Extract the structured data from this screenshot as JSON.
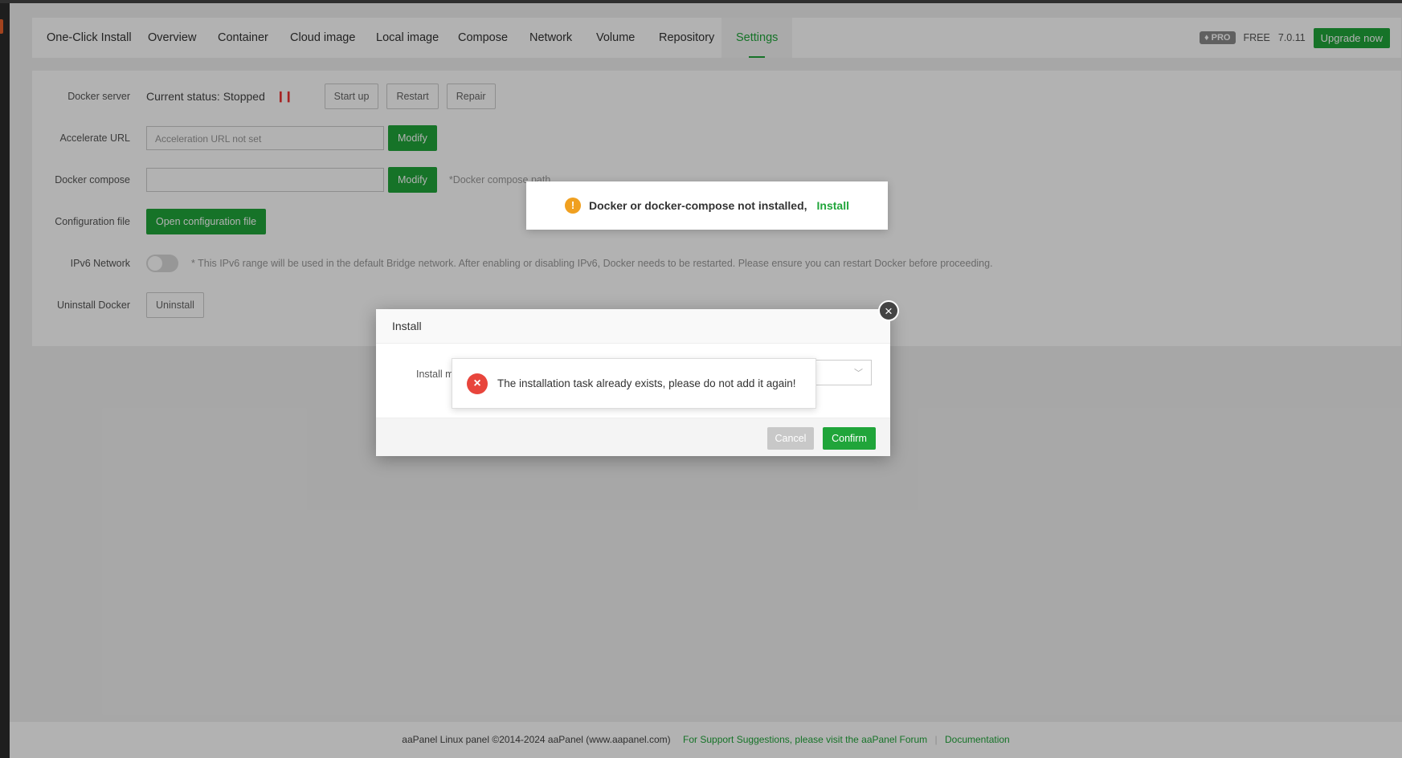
{
  "tabs": [
    {
      "label": "One-Click Install"
    },
    {
      "label": "Overview"
    },
    {
      "label": "Container"
    },
    {
      "label": "Cloud image"
    },
    {
      "label": "Local image"
    },
    {
      "label": "Compose"
    },
    {
      "label": "Network"
    },
    {
      "label": "Volume"
    },
    {
      "label": "Repository"
    },
    {
      "label": "Settings",
      "active": true
    }
  ],
  "header_right": {
    "pro_label": "PRO",
    "plan_label": "FREE",
    "version": "7.0.11",
    "upgrade_label": "Upgrade now"
  },
  "settings": {
    "docker_server": {
      "label": "Docker server",
      "status": "Current status: Stopped",
      "start_label": "Start up",
      "restart_label": "Restart",
      "repair_label": "Repair"
    },
    "accelerate": {
      "label": "Accelerate URL",
      "placeholder": "Acceleration URL not set",
      "modify_label": "Modify"
    },
    "compose": {
      "label": "Docker compose",
      "value": "",
      "modify_label": "Modify",
      "hint": "*Docker compose path"
    },
    "config": {
      "label": "Configuration file",
      "open_label": "Open configuration file"
    },
    "ipv6": {
      "label": "IPv6 Network",
      "enabled": false,
      "hint": "* This IPv6 range will be used in the default Bridge network. After enabling or disabling IPv6, Docker needs to be restarted. Please ensure you can restart Docker before proceeding."
    },
    "uninstall": {
      "label": "Uninstall Docker",
      "button_label": "Uninstall"
    }
  },
  "warning_toast": {
    "message": "Docker or docker-compose not installed,",
    "install_link": "Install"
  },
  "modal": {
    "title": "Install",
    "install_label": "Install m",
    "cancel_label": "Cancel",
    "confirm_label": "Confirm"
  },
  "error_toast": {
    "message": "The installation task already exists, please do not add it again!"
  },
  "footer": {
    "copyright": "aaPanel Linux panel ©2014-2024 aaPanel (www.aapanel.com)",
    "support_link": "For Support Suggestions, please visit the aaPanel Forum",
    "docs_link": "Documentation"
  },
  "colors": {
    "accent": "#20a53a",
    "error": "#e8453c",
    "warning": "#f0a020"
  }
}
